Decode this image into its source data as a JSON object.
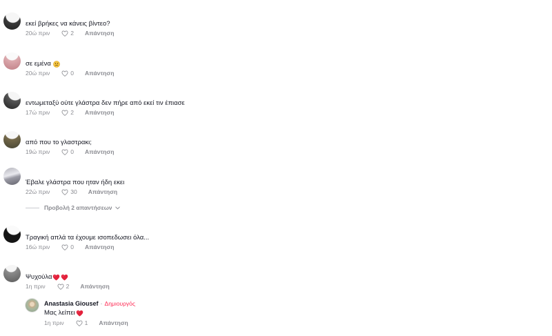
{
  "labels": {
    "reply": "Απάντηση"
  },
  "colors": {
    "text": "#161823",
    "meta": "#8a8b91",
    "creator_badge": "#fe2c55",
    "heart_emoji": "#e3223c"
  },
  "comments": [
    {
      "text": "εκεί βρήκες να κάνεις βίντεο?",
      "time": "20ώ πριν",
      "likes": "2"
    },
    {
      "text": "σε εμένα",
      "emoji": [
        "slightly-frowning-face-icon"
      ],
      "time": "20ώ πριν",
      "likes": "0"
    },
    {
      "text": "εντωμεταξύ ούτε γλάστρα δεν πήρε από εκεί τιν έπιασε",
      "time": "17ώ πριν",
      "likes": "2"
    },
    {
      "text": "από που το γλαστρακι;",
      "time": "19ώ πριν",
      "likes": "0"
    },
    {
      "text": "Έβαλε γλάστρα που ηταν ήδη εκει",
      "time": "22ώ πριν",
      "likes": "30",
      "view_replies": "Προβολή 2 απαντήσεων"
    },
    {
      "text": "Τραγική απλά τα έχουμε ισοπεδωσει όλα...",
      "time": "16ώ πριν",
      "likes": "0"
    },
    {
      "text": "Ψυχούλα",
      "emoji": [
        "red-heart-icon",
        "red-heart-icon"
      ],
      "time": "1η πριν",
      "likes": "2",
      "replies": [
        {
          "author": "Anastasia Giousef",
          "separator": "·",
          "badge": "Δημιουργός",
          "text": "Μας λείπει",
          "emoji": [
            "red-heart-icon"
          ],
          "time": "1η πριν",
          "likes": "1"
        }
      ]
    }
  ]
}
